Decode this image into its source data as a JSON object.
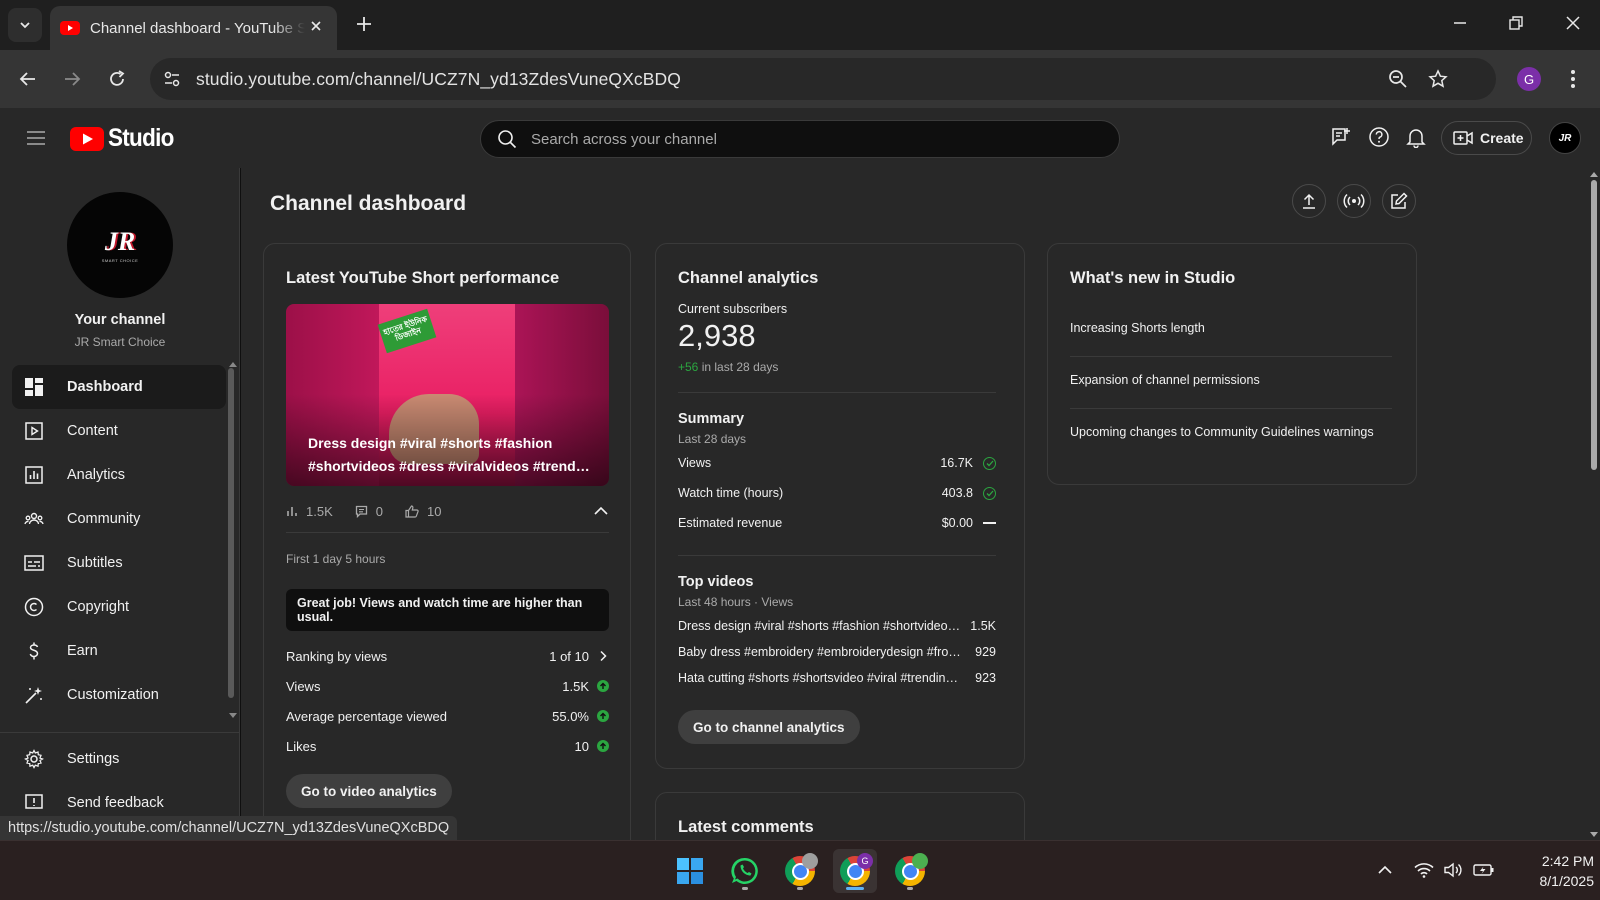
{
  "browser": {
    "tab_title": "Channel dashboard - YouTube Studio",
    "url": "studio.youtube.com/channel/UCZ7N_yd13ZdesVuneQXcBDQ",
    "profile_initial": "G",
    "status_url": "https://studio.youtube.com/channel/UCZ7N_yd13ZdesVuneQXcBDQ"
  },
  "header": {
    "logo_text": "Studio",
    "search_placeholder": "Search across your channel",
    "create_label": "Create",
    "avatar_text": "JR"
  },
  "sidebar": {
    "avatar_text": "JR",
    "avatar_subtext": "SMART CHOICE",
    "your_channel": "Your channel",
    "channel_name": "JR Smart Choice",
    "items": [
      {
        "label": "Dashboard",
        "icon": "dashboard-icon",
        "active": true
      },
      {
        "label": "Content",
        "icon": "content-icon"
      },
      {
        "label": "Analytics",
        "icon": "analytics-icon"
      },
      {
        "label": "Community",
        "icon": "community-icon"
      },
      {
        "label": "Subtitles",
        "icon": "subtitles-icon"
      },
      {
        "label": "Copyright",
        "icon": "copyright-icon"
      },
      {
        "label": "Earn",
        "icon": "earn-icon"
      },
      {
        "label": "Customization",
        "icon": "customization-icon"
      }
    ],
    "settings": "Settings",
    "feedback": "Send feedback"
  },
  "main": {
    "title": "Channel dashboard",
    "short_card": {
      "title": "Latest YouTube Short performance",
      "thumbnail_sticker": "হাতের ইউনিক ডিজাইন",
      "caption_line1": "Dress design #viral #shorts #fashion",
      "caption_line2": "#shortvideos #dress #viralvideos #trending",
      "views": "1.5K",
      "comments": "0",
      "likes": "10",
      "period": "First 1 day 5 hours",
      "highlight": "Great job! Views and watch time are higher than usual.",
      "metrics": [
        {
          "label": "Ranking by views",
          "value": "1 of 10",
          "indicator": "chevron"
        },
        {
          "label": "Views",
          "value": "1.5K",
          "indicator": "up"
        },
        {
          "label": "Average percentage viewed",
          "value": "55.0%",
          "indicator": "up"
        },
        {
          "label": "Likes",
          "value": "10",
          "indicator": "up"
        }
      ],
      "button": "Go to video analytics"
    },
    "analytics_card": {
      "title": "Channel analytics",
      "subs_label": "Current subscribers",
      "subs_value": "2,938",
      "subs_delta": "+56",
      "subs_delta_suffix": "in last 28 days",
      "summary_title": "Summary",
      "summary_period": "Last 28 days",
      "summary": [
        {
          "label": "Views",
          "value": "16.7K",
          "indicator": "check"
        },
        {
          "label": "Watch time (hours)",
          "value": "403.8",
          "indicator": "check"
        },
        {
          "label": "Estimated revenue",
          "value": "$0.00",
          "indicator": "dash"
        }
      ],
      "top_title": "Top videos",
      "top_period": "Last 48 hours · Views",
      "top_videos": [
        {
          "title": "Dress design #viral #shorts #fashion #shortvideos #dress",
          "views": "1.5K"
        },
        {
          "title": "Baby dress #embroidery #embroiderydesign #frock #shorts",
          "views": "929"
        },
        {
          "title": "Hata cutting #shorts #shortsvideo #viral #trending #fashion",
          "views": "923"
        }
      ],
      "button": "Go to channel analytics"
    },
    "comments_card": {
      "title": "Latest comments"
    },
    "news_card": {
      "title": "What's new in Studio",
      "items": [
        "Increasing Shorts length",
        "Expansion of channel permissions",
        "Upcoming changes to Community Guidelines warnings"
      ]
    }
  },
  "taskbar": {
    "time": "2:42 PM",
    "date": "8/1/2025",
    "chrome_badge": "G"
  },
  "colors": {
    "accent_red": "#ff0000",
    "positive_green": "#2ba640",
    "background": "#282828"
  }
}
